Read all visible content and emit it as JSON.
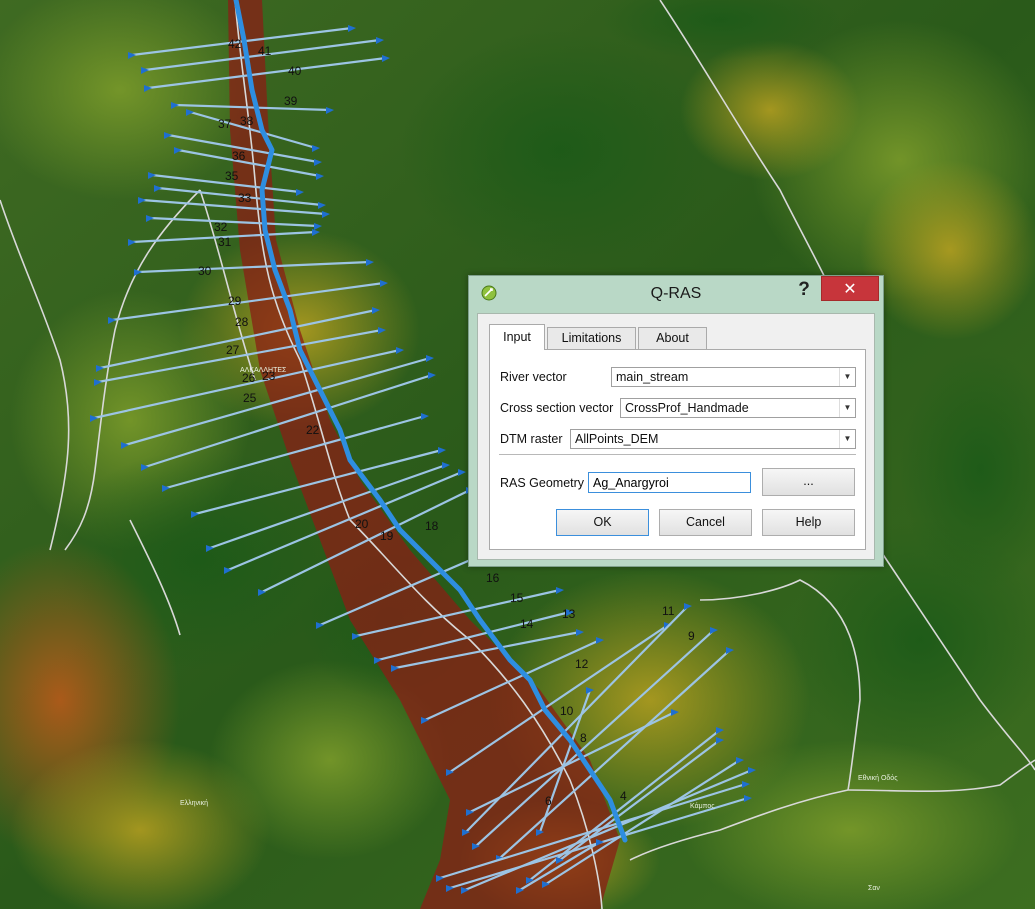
{
  "dialog": {
    "title": "Q-RAS",
    "help_glyph": "?",
    "close_glyph": "✕",
    "app_icon": "qgis-plugin-icon",
    "tabs": [
      {
        "label": "Input",
        "selected": true
      },
      {
        "label": "Limitations",
        "selected": false
      },
      {
        "label": "About",
        "selected": false
      }
    ],
    "fields": {
      "river_vector": {
        "label": "River vector",
        "value": "main_stream"
      },
      "cross_section_vector": {
        "label": "Cross section vector",
        "value": "CrossProf_Handmade"
      },
      "dtm_raster": {
        "label": "DTM raster",
        "value": "AllPoints_DEM"
      },
      "ras_geometry": {
        "label": "RAS Geometry",
        "value": "Ag_Anargyroi"
      }
    },
    "buttons": {
      "browse": "...",
      "ok": "OK",
      "cancel": "Cancel",
      "help": "Help"
    }
  },
  "map": {
    "colors": {
      "river": "#2e8ee0",
      "cross_section": "#9cc4e4",
      "cross_section_arrow": "#1f6fd0",
      "road": "#d8d8d8",
      "channel_dem": "#8a1f15"
    },
    "cross_section_labels": [
      "4",
      "6",
      "8",
      "9",
      "10",
      "11",
      "12",
      "13",
      "14",
      "15",
      "16",
      "18",
      "19",
      "20",
      "22",
      "23",
      "25",
      "26",
      "27",
      "28",
      "29",
      "30",
      "31",
      "32",
      "33",
      "35",
      "36",
      "37",
      "38",
      "39",
      "40",
      "41",
      "42"
    ]
  }
}
